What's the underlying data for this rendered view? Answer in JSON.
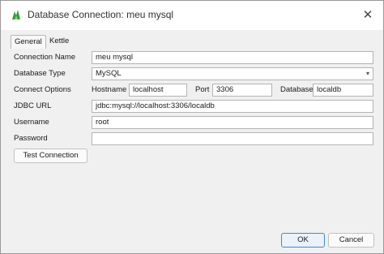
{
  "window": {
    "title": "Database Connection: meu mysql",
    "app_icon": "pentaho-kettle-icon",
    "close_glyph": "✕"
  },
  "tabs": [
    {
      "label": "General",
      "active": true
    },
    {
      "label": "Kettle",
      "active": false
    }
  ],
  "form": {
    "connection_name": {
      "label": "Connection Name",
      "value": "meu mysql"
    },
    "database_type": {
      "label": "Database Type",
      "value": "MySQL"
    },
    "connect_options": {
      "label": "Connect Options",
      "hostname_label": "Hostname",
      "hostname_value": "localhost",
      "port_label": "Port",
      "port_value": "3306",
      "database_label": "Database",
      "database_value": "localdb"
    },
    "jdbc_url": {
      "label": "JDBC URL",
      "value": "jdbc:mysql://localhost:3306/localdb"
    },
    "username": {
      "label": "Username",
      "value": "root"
    },
    "password": {
      "label": "Password",
      "value": ""
    }
  },
  "buttons": {
    "test_connection": "Test Connection",
    "ok": "OK",
    "cancel": "Cancel"
  },
  "colors": {
    "accent": "#4a86c8",
    "icon_green": "#2e9e3e"
  }
}
